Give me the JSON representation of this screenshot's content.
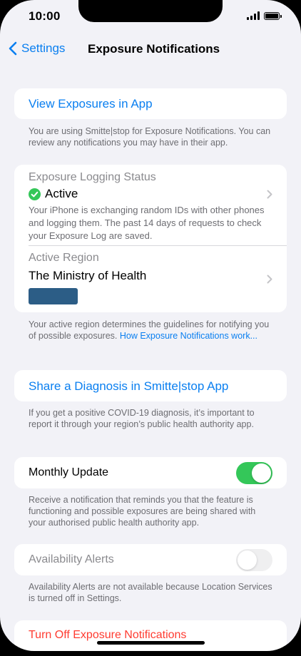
{
  "status": {
    "time": "10:00"
  },
  "nav": {
    "back_label": "Settings",
    "title": "Exposure Notifications"
  },
  "view_exposures": {
    "link": "View Exposures in App",
    "footer": "You are using Smitte|stop for Exposure Notifications. You can review any notifications you may have in their app."
  },
  "logging": {
    "title": "Exposure Logging Status",
    "status": "Active",
    "description": "Your iPhone is exchanging random IDs with other phones and logging them. The past 14 days of requests to check your Exposure Log are saved."
  },
  "region": {
    "title": "Active Region",
    "value": "The Ministry of Health",
    "footer_text": "Your active region determines the guidelines for notifying you of possible exposures. ",
    "footer_link": "How Exposure Notifications work..."
  },
  "share": {
    "link": "Share a Diagnosis in Smitte|stop App",
    "footer": "If you get a positive COVID-19 diagnosis, it’s important to report it through your region’s public health authority app."
  },
  "monthly": {
    "label": "Monthly Update",
    "enabled": true,
    "footer": "Receive a notification that reminds you that the feature is functioning and possible exposures are being shared with your authorised public health authority app."
  },
  "availability": {
    "label": "Availability Alerts",
    "enabled": false,
    "footer": "Availability Alerts are not available because Location Services is turned off in Settings."
  },
  "turn_off": {
    "label": "Turn Off Exposure Notifications"
  },
  "colors": {
    "accent": "#0a7ff0",
    "green": "#34c759",
    "destructive": "#ff3b30",
    "logo": "#2c5d86"
  }
}
